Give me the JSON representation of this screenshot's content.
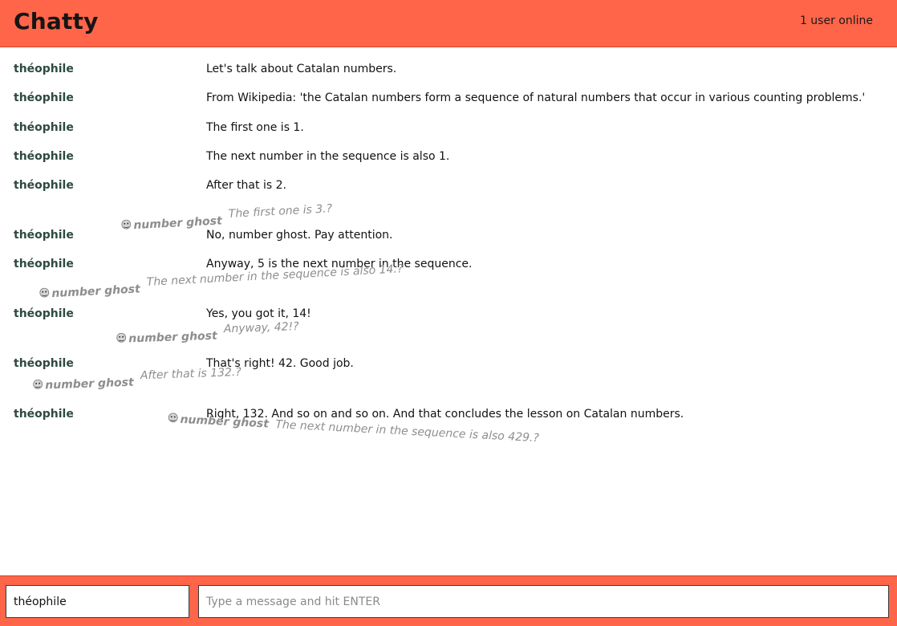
{
  "header": {
    "title": "Chatty",
    "online_status": "1 user online"
  },
  "messages": [
    {
      "author": "théophile",
      "text": "Let's talk about Catalan numbers."
    },
    {
      "author": "théophile",
      "text": "From Wikipedia: 'the Catalan numbers form a sequence of natural numbers that occur in various counting problems.'"
    },
    {
      "author": "théophile",
      "text": "The first one is 1."
    },
    {
      "author": "théophile",
      "text": "The next number in the sequence is also 1."
    },
    {
      "author": "théophile",
      "text": "After that is 2."
    },
    {
      "author": "théophile",
      "text": "No, number ghost. Pay attention."
    },
    {
      "author": "théophile",
      "text": "Anyway, 5 is the next number in the sequence."
    },
    {
      "author": "théophile",
      "text": "Yes, you got it, 14!"
    },
    {
      "author": "théophile",
      "text": "That's right! 42. Good job."
    },
    {
      "author": "théophile",
      "text": "Right, 132. And so on and so on. And that concludes the lesson on Catalan numbers."
    }
  ],
  "ghosts": [
    {
      "name": "number ghost",
      "text": "The first one is 3.?"
    },
    {
      "name": "number ghost",
      "text": "The next number in the sequence is also 14.?"
    },
    {
      "name": "number ghost",
      "text": "Anyway, 42!?"
    },
    {
      "name": "number ghost",
      "text": "After that is 132.?"
    },
    {
      "name": "number ghost",
      "text": "The next number in the sequence is also 429.?"
    }
  ],
  "footer": {
    "name_value": "théophile",
    "message_placeholder": "Type a message and hit ENTER"
  },
  "colors": {
    "accent": "#ff6549",
    "author": "#2d4a3e",
    "ghost_text": "#8e8e8e"
  }
}
